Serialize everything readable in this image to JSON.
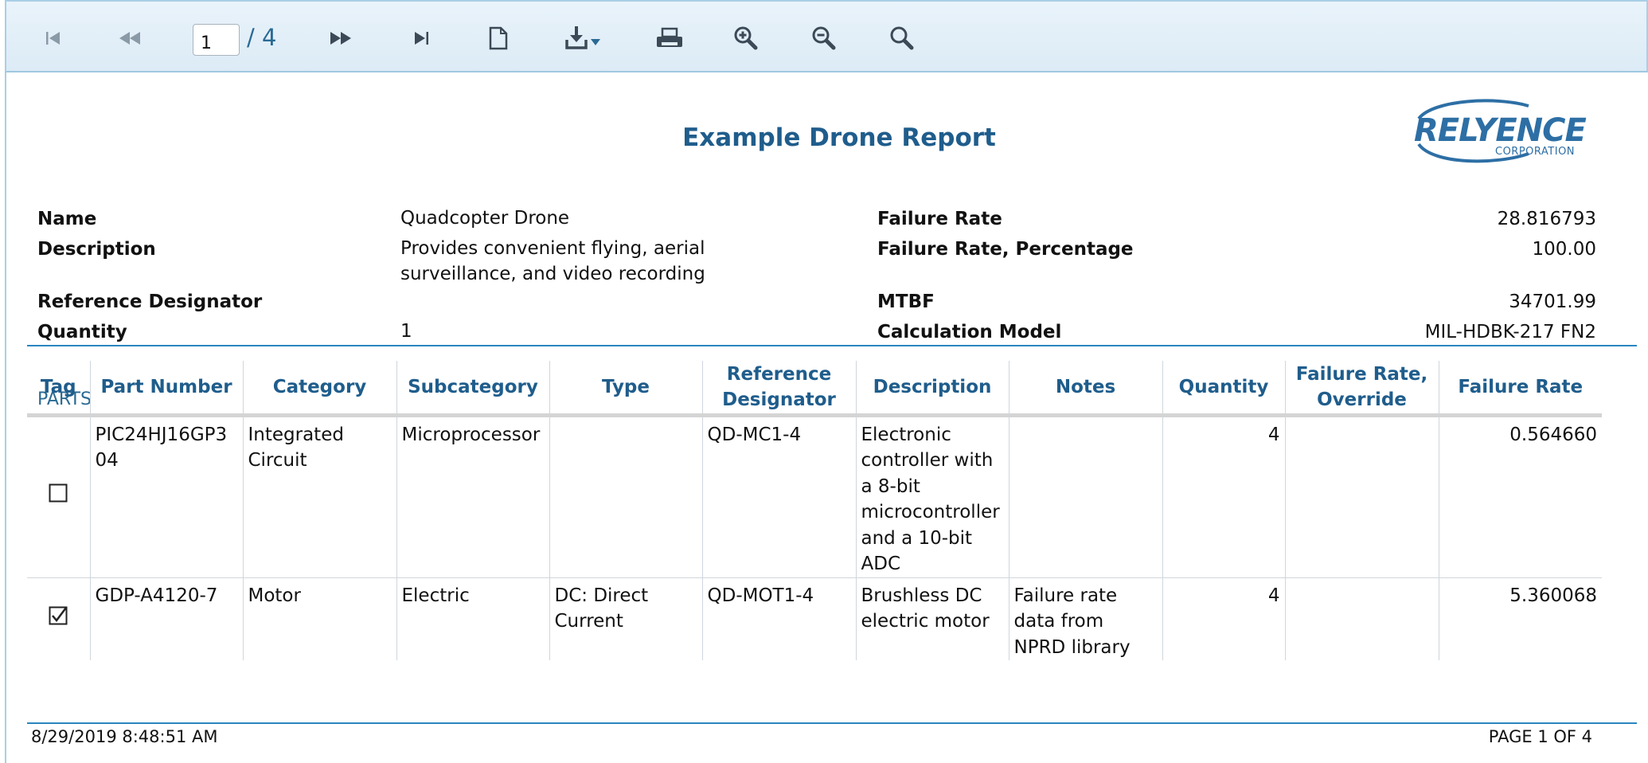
{
  "toolbar": {
    "page_current": "1",
    "page_total": "/ 4",
    "buttons": [
      "first-page",
      "previous-page",
      "next-page",
      "last-page",
      "export",
      "download",
      "print",
      "zoom-in",
      "zoom-out",
      "search"
    ]
  },
  "report": {
    "title": "Example Drone Report",
    "logo": {
      "main": "RELYENCE",
      "sub": "CORPORATION",
      "color": "#2d6fa5"
    },
    "header": {
      "name_label": "Name",
      "name_value": "Quadcopter Drone",
      "description_label": "Description",
      "description_value": "Provides convenient flying, aerial surveillance, and video recording",
      "refdes_label": "Reference Designator",
      "refdes_value": "",
      "quantity_label": "Quantity",
      "quantity_value": "1",
      "failure_rate_label": "Failure Rate",
      "failure_rate_value": "28.816793",
      "failure_rate_pct_label": "Failure Rate, Percentage",
      "failure_rate_pct_value": "100.00",
      "mtbf_label": "MTBF",
      "mtbf_value": "34701.99",
      "calc_model_label": "Calculation Model",
      "calc_model_value": "MIL-HDBK-217 FN2"
    },
    "parts": {
      "section_title": "PARTS",
      "columns": [
        "Tag",
        "Part Number",
        "Category",
        "Subcategory",
        "Type",
        "Reference Designator",
        "Description",
        "Notes",
        "Quantity",
        "Failure Rate, Override",
        "Failure Rate"
      ],
      "rows": [
        {
          "tag_checked": false,
          "part_number": "PIC24HJ16GP304",
          "category": "Integrated Circuit",
          "subcategory": "Microprocessor",
          "type": "",
          "ref_designator": "QD-MC1-4",
          "description": "Electronic controller with a 8-bit microcontroller and a 10-bit ADC",
          "notes": "",
          "quantity": "4",
          "failure_rate_override": "",
          "failure_rate": "0.564660"
        },
        {
          "tag_checked": true,
          "part_number": "GDP-A4120-7",
          "category": "Motor",
          "subcategory": "Electric",
          "type": "DC: Direct Current",
          "ref_designator": "QD-MOT1-4",
          "description": "Brushless DC electric motor",
          "notes": "Failure rate data from NPRD library",
          "quantity": "4",
          "failure_rate_override": "",
          "failure_rate": "5.360068"
        }
      ]
    },
    "footer": {
      "timestamp": "8/29/2019 8:48:51 AM",
      "page": "PAGE 1 OF 4"
    }
  }
}
